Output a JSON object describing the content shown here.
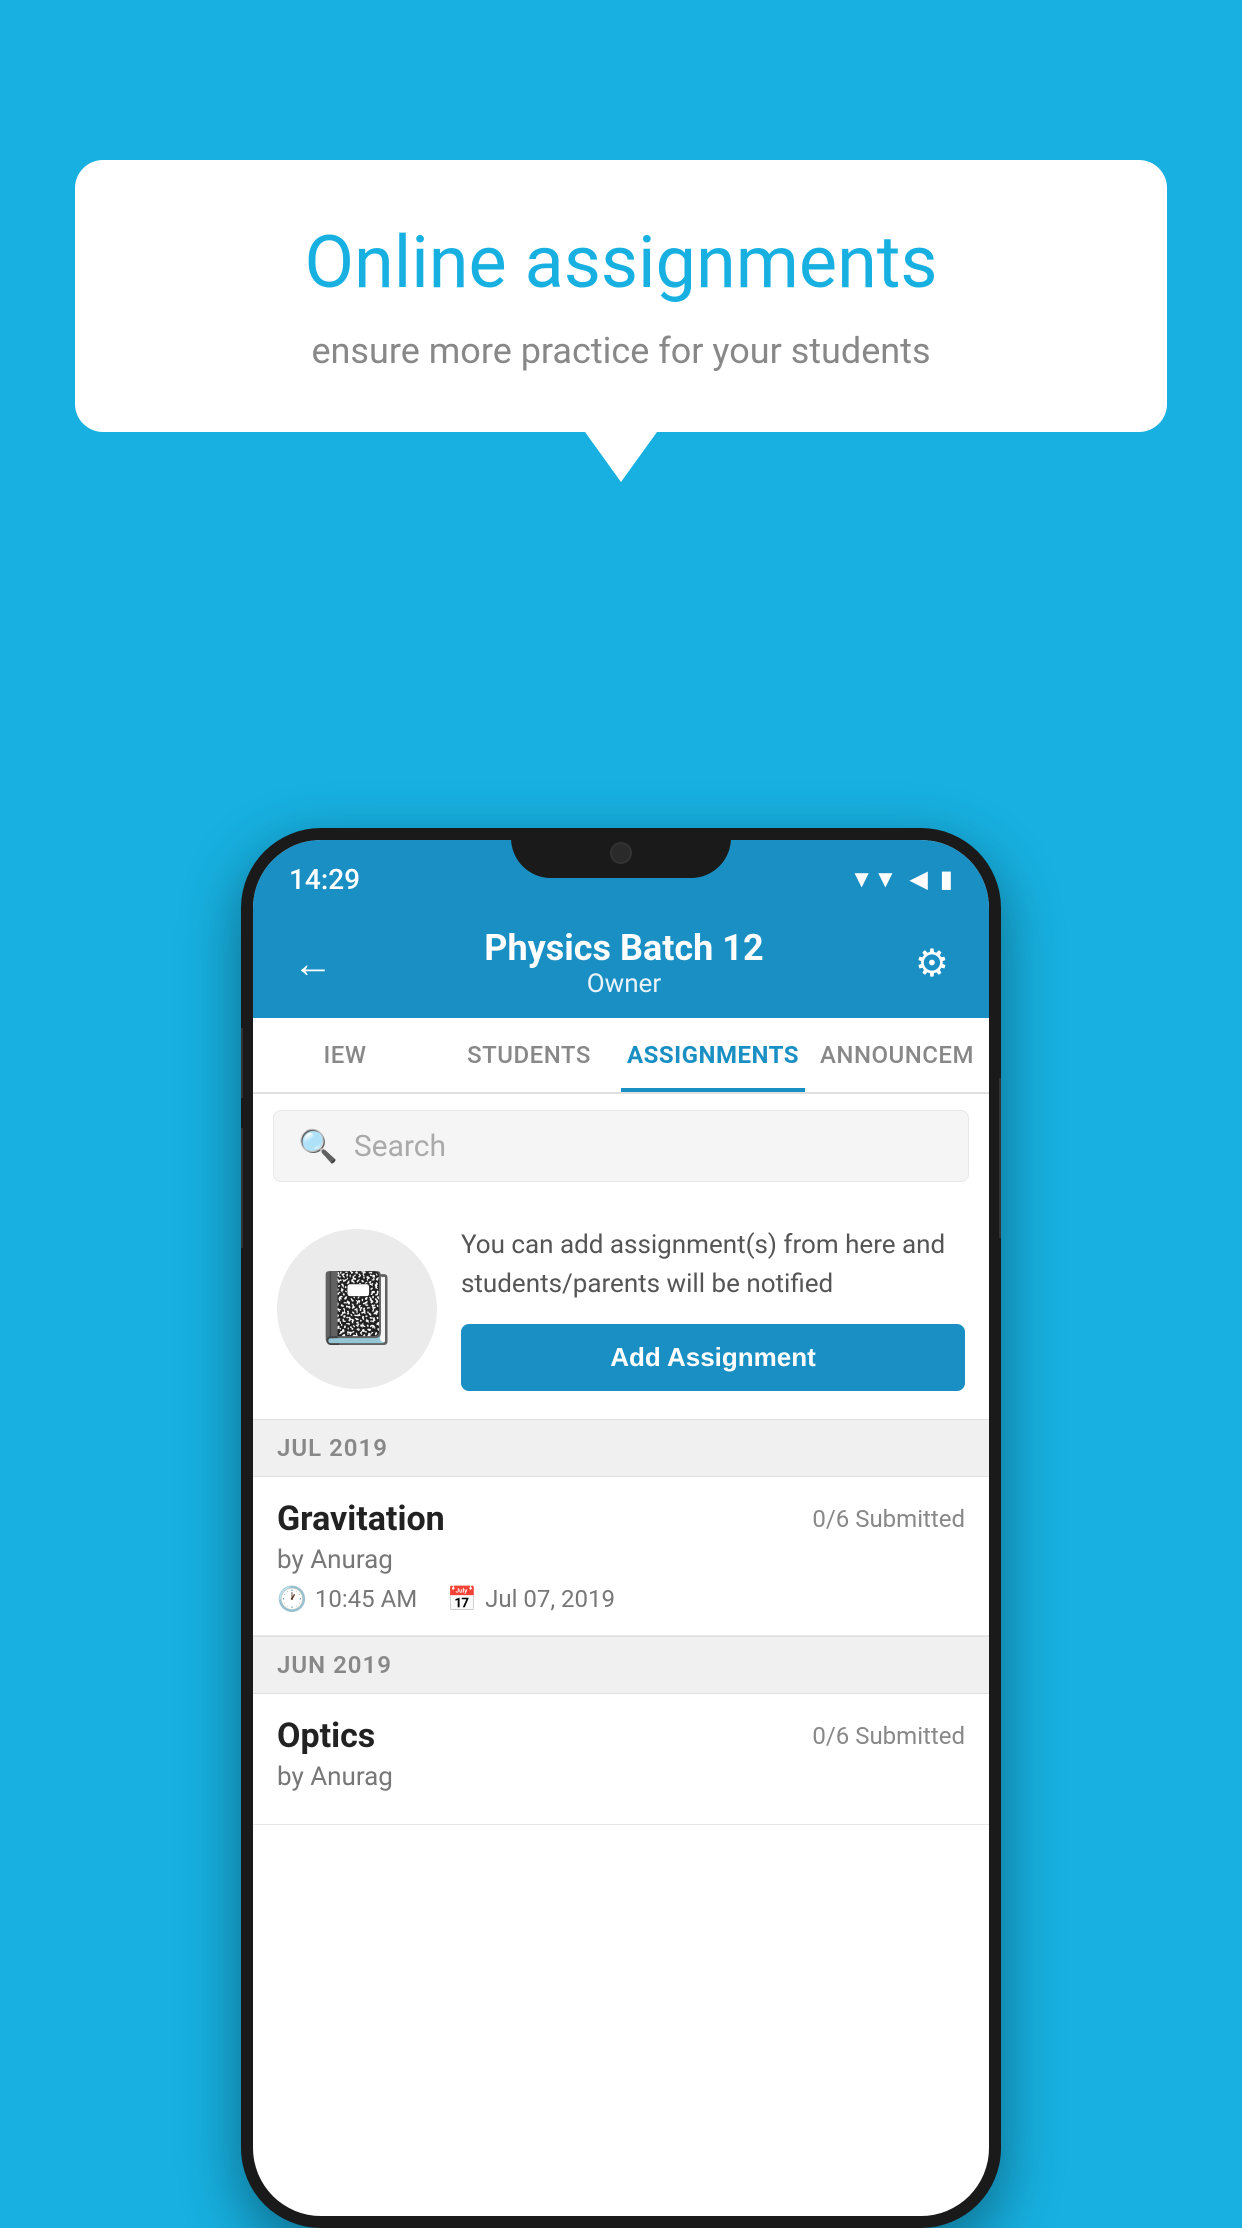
{
  "background_color": "#17b0e0",
  "speech_bubble": {
    "title": "Online assignments",
    "subtitle": "ensure more practice for your students"
  },
  "status_bar": {
    "time": "14:29",
    "wifi_icon": "▲",
    "signal_icon": "▲",
    "battery_icon": "▮"
  },
  "top_nav": {
    "back_icon": "←",
    "title": "Physics Batch 12",
    "subtitle": "Owner",
    "settings_icon": "⚙"
  },
  "tabs": [
    {
      "label": "IEW",
      "active": false
    },
    {
      "label": "STUDENTS",
      "active": false
    },
    {
      "label": "ASSIGNMENTS",
      "active": true
    },
    {
      "label": "ANNOUNCEM",
      "active": false
    }
  ],
  "search": {
    "placeholder": "Search",
    "icon": "🔍"
  },
  "promo_card": {
    "description": "You can add assignment(s) from here and students/parents will be notified",
    "button_label": "Add Assignment"
  },
  "sections": [
    {
      "label": "JUL 2019",
      "assignments": [
        {
          "title": "Gravitation",
          "submitted": "0/6 Submitted",
          "author": "by Anurag",
          "time": "10:45 AM",
          "date": "Jul 07, 2019"
        }
      ]
    },
    {
      "label": "JUN 2019",
      "assignments": [
        {
          "title": "Optics",
          "submitted": "0/6 Submitted",
          "author": "by Anurag",
          "time": "",
          "date": ""
        }
      ]
    }
  ]
}
